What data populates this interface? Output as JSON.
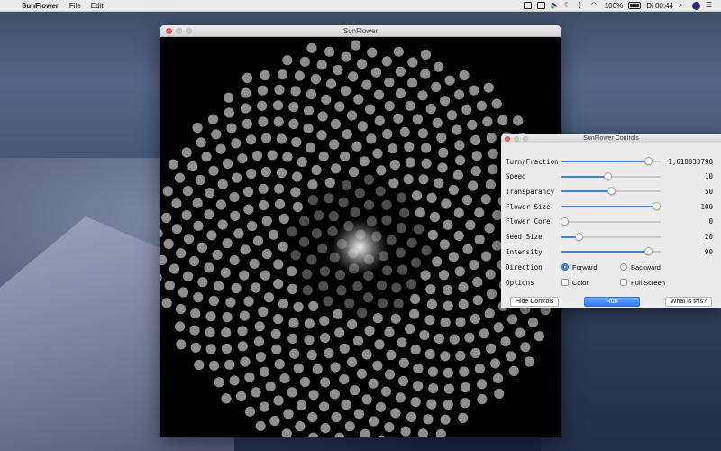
{
  "menubar": {
    "app_name": "SunFlower",
    "menus": [
      "File",
      "Edit"
    ],
    "battery": "100%",
    "clock": "Di 00:44"
  },
  "main_window": {
    "title": "SunFlower"
  },
  "controls_window": {
    "title": "SunFlower Controls",
    "rows": [
      {
        "label": "Turn/Fraction",
        "value": "1,618033790",
        "level": 0.88
      },
      {
        "label": "Speed",
        "value": "10",
        "level": 0.47
      },
      {
        "label": "Transparancy",
        "value": "50",
        "level": 0.5
      },
      {
        "label": "Flower Size",
        "value": "100",
        "level": 0.96
      },
      {
        "label": "Flower Core",
        "value": "0",
        "level": 0.03
      },
      {
        "label": "Seed Size",
        "value": "20",
        "level": 0.18
      },
      {
        "label": "Intensity",
        "value": "90",
        "level": 0.88
      }
    ],
    "direction": {
      "label": "Direction",
      "options": [
        "Forward",
        "Backward"
      ],
      "selected": "Forward"
    },
    "options": {
      "label": "Options",
      "items": [
        "Color",
        "Full Screen"
      ]
    },
    "buttons": {
      "hide": "Hide Controls",
      "run": "Run",
      "about": "What is this?"
    }
  },
  "colors": {
    "accent": "#3b82f6",
    "seed": "#8e8e8e",
    "canvas_bg": "#000000"
  }
}
